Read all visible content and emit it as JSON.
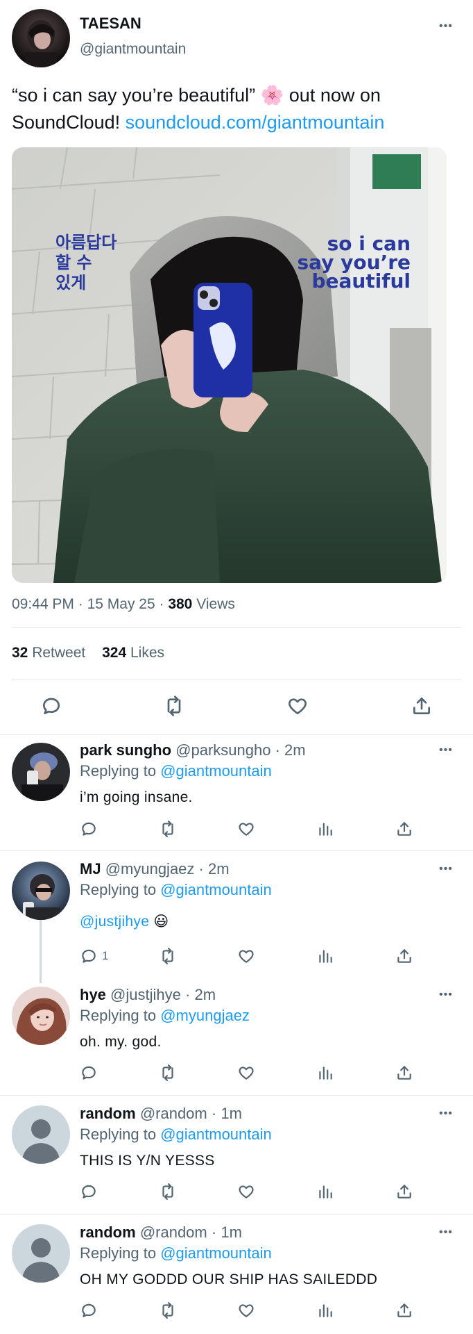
{
  "tweet": {
    "author_name": "TAESAN",
    "author_handle": "@giantmountain",
    "text_line1": "“so i can say you’re beautiful” 🌸 out now on",
    "text_line2_prefix": "SoundCloud!",
    "text_link": "soundcloud.com/giantmountain",
    "image_text_korean_1": "아름답다",
    "image_text_korean_2": "할 수",
    "image_text_korean_3": "있게",
    "image_text_english_1": "so i can",
    "image_text_english_2": "say you’re",
    "image_text_english_3": "beautiful",
    "time": "09:44 PM",
    "date": "15 May 25",
    "views_count": "380",
    "views_label": "Views",
    "retweet_count": "32",
    "retweet_label": "Retweet",
    "likes_count": "324",
    "likes_label": "Likes"
  },
  "replies": [
    {
      "name": "park sungho",
      "handle": "@parksungho",
      "time": "2m",
      "replying_label": "Replying to",
      "replying_to": "@giantmountain",
      "text": "i’m going insane.",
      "reply_count": ""
    },
    {
      "name": "MJ",
      "handle": "@myungjaez",
      "time": "2m",
      "replying_label": "Replying to",
      "replying_to": "@giantmountain",
      "mention": "@justjihye",
      "emoji": "😃",
      "reply_count": "1"
    },
    {
      "name": "hye",
      "handle": "@justjihye",
      "time": "2m",
      "replying_label": "Replying to",
      "replying_to": "@myungjaez",
      "text": "oh. my. god.",
      "reply_count": ""
    },
    {
      "name": "random",
      "handle": "@random",
      "time": "1m",
      "replying_label": "Replying to",
      "replying_to": "@giantmountain",
      "text": "THIS IS Y/N YESSS",
      "reply_count": ""
    },
    {
      "name": "random",
      "handle": "@random",
      "time": "1m",
      "replying_label": "Replying to",
      "replying_to": "@giantmountain",
      "text": "OH MY GODDD OUR SHIP HAS SAILEDDD",
      "reply_count": ""
    }
  ],
  "ui": {
    "more_glyph": "•••",
    "dot": "·"
  },
  "colors": {
    "link": "#1d9bf0",
    "muted": "#536471",
    "text": "#0f1419",
    "image_text": "#2a3a9c"
  }
}
